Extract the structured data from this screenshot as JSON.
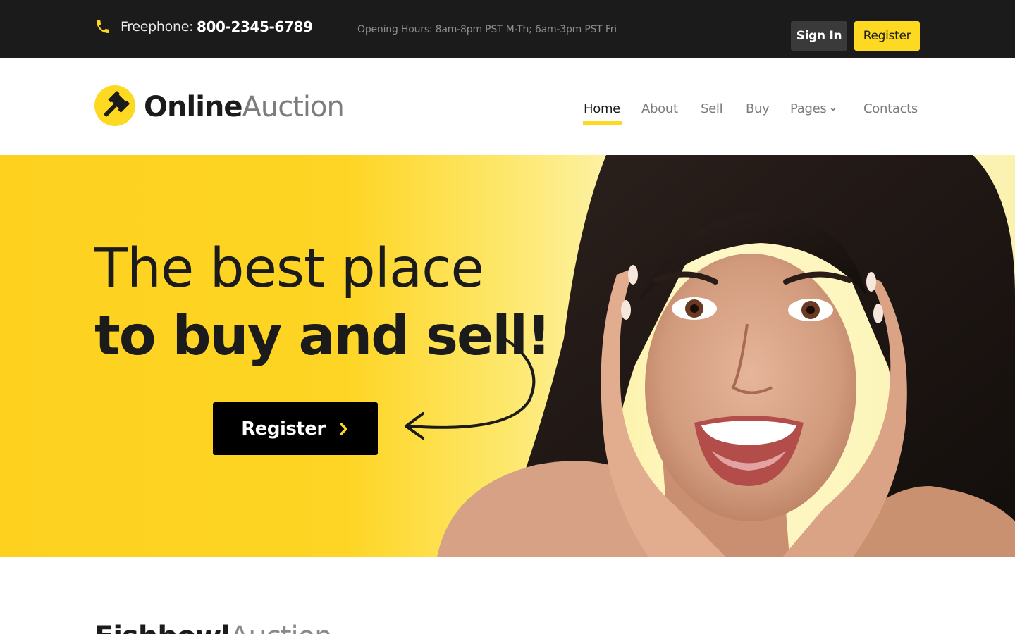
{
  "topbar": {
    "phone_icon": "phone-icon",
    "freephone_label": "Freephone:",
    "freephone_number": "800-2345-6789",
    "opening_hours": "Opening Hours: 8am-8pm PST M-Th; 6am-3pm PST Fri",
    "sign_in_label": "Sign In",
    "register_label": "Register"
  },
  "header": {
    "logo_icon": "gavel-icon",
    "logo_bold": "Online",
    "logo_light": "Auction",
    "nav": [
      {
        "label": "Home",
        "active": true
      },
      {
        "label": "About",
        "active": false
      },
      {
        "label": "Sell",
        "active": false
      },
      {
        "label": "Buy",
        "active": false
      },
      {
        "label": "Pages",
        "active": false,
        "has_dropdown": true
      },
      {
        "label": "Contacts",
        "active": false
      }
    ]
  },
  "hero": {
    "headline_line1": "The best place",
    "headline_line2": "to buy and sell!",
    "cta_label": "Register",
    "cta_icon": "chevron-right-icon",
    "image": "smiling woman with hands on cheeks"
  },
  "section": {
    "title_bold": "Fishbowl",
    "title_light": "Auction"
  },
  "colors": {
    "accent": "#fed921",
    "topbar_bg": "#1b1b1b",
    "text_dark": "#1b1b1b",
    "text_muted": "#7b7b7b"
  }
}
